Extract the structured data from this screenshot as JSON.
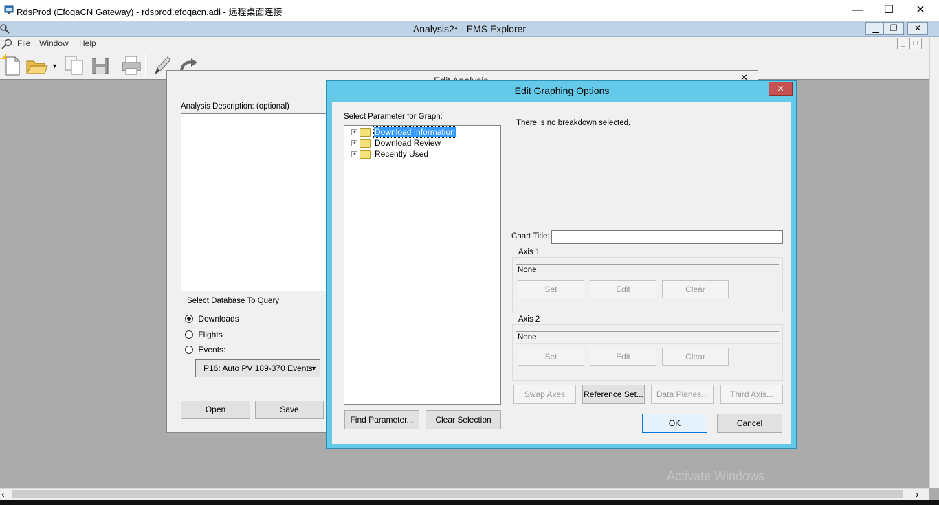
{
  "rdp": {
    "title": "RdsProd (EfoqaCN Gateway) - rdsprod.efoqacn.adi - 远程桌面连接",
    "minimize_glyph": "—",
    "maximize_glyph": "☐",
    "close_glyph": "✕"
  },
  "app": {
    "title": "Analysis2* - EMS Explorer",
    "minimize_glyph": "▁",
    "restore_glyph": "❐",
    "close_glyph": "✕"
  },
  "menu": {
    "items": [
      "File",
      "Window",
      "Help"
    ],
    "mdi_min": "_",
    "mdi_restore": "❐"
  },
  "toolbar": {
    "icons": [
      "new-document-icon",
      "open-folder-icon",
      "copy-icon",
      "save-icon",
      "print-icon",
      "edit-pencil-icon",
      "redo-icon"
    ]
  },
  "edit_analysis": {
    "title": "Edit Analysis",
    "close_glyph": "✕",
    "description_label": "Analysis Description: (optional)",
    "description_value": "",
    "db_group_label": "Select Database To Query",
    "db_options": [
      {
        "label": "Downloads",
        "checked": true
      },
      {
        "label": "Flights",
        "checked": false
      },
      {
        "label": "Events:",
        "checked": false
      }
    ],
    "events_selected": "P16: Auto PV 189-370 Events",
    "open_label": "Open",
    "save_label": "Save"
  },
  "graphing": {
    "title": "Edit Graphing Options",
    "close_glyph": "✕",
    "param_label": "Select Parameter for Graph:",
    "tree": [
      {
        "label": "Download Information",
        "selected": true
      },
      {
        "label": "Download Review",
        "selected": false
      },
      {
        "label": "Recently Used",
        "selected": false
      }
    ],
    "find_param_label": "Find Parameter...",
    "clear_selection_label": "Clear Selection",
    "breakdown_text": "There is no breakdown selected.",
    "chart_title_label": "Chart Title:",
    "chart_title_value": "",
    "axis1": {
      "legend": "Axis 1",
      "value": "None",
      "set": "Set",
      "edit": "Edit",
      "clear": "Clear"
    },
    "axis2": {
      "legend": "Axis 2",
      "value": "None",
      "set": "Set",
      "edit": "Edit",
      "clear": "Clear"
    },
    "swap_axes_label": "Swap Axes",
    "reference_set_label": "Reference Set...",
    "data_planes_label": "Data Planes...",
    "third_axis_label": "Third Axis...",
    "ok_label": "OK",
    "cancel_label": "Cancel"
  },
  "watermark": "Activate Windows",
  "scroll": {
    "left_arrow": "‹",
    "right_arrow": "›"
  },
  "colors": {
    "dialog_frame": "#65c9e9",
    "close_red": "#c75050",
    "selection": "#3399ff"
  }
}
